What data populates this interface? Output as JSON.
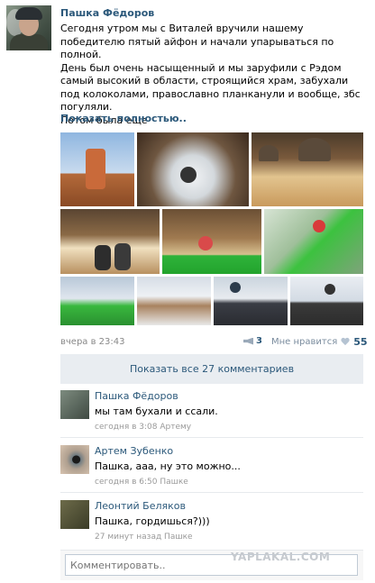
{
  "post": {
    "author": "Пашка Фёдоров",
    "text_lines": [
      "Сегодня утром мы с Виталей вручили нашему победителю пятый айфон и начали упарываться по полной.",
      "День был очень насыщенный и мы заруфили с Рэдом самый высокий в области, строящийся храм, забухали под колоколами, православно планканули и вообще, збс погуляли.",
      "Потом была еще"
    ],
    "show_more": "Показать полностью..",
    "time": "вчера в 23:43",
    "shares": "3",
    "likes_label": "Мне нравится",
    "likes_count": "55",
    "show_all_comments": "Показать все 27 комментариев"
  },
  "comments": [
    {
      "name": "Пашка Фёдоров",
      "text": "мы там бухали и ссали.",
      "meta": "сегодня в 3:08 Артему"
    },
    {
      "name": "Артем Зубенко",
      "text": "Пашка, ааа, ну это можно...",
      "meta": "сегодня в 6:50 Пашке"
    },
    {
      "name": "Леонтий Беляков",
      "text": "Пашка, гордишься?)))",
      "meta": "27 минут назад Пашке"
    }
  ],
  "comment_box": {
    "placeholder": "Комментировать.."
  },
  "watermark": "YAPLAKAL.COM",
  "icons": {
    "share": "megaphone-icon",
    "like": "heart-icon"
  },
  "colors": {
    "link": "#2b587a",
    "meta": "#999999",
    "button_bg": "#e9edf1"
  }
}
